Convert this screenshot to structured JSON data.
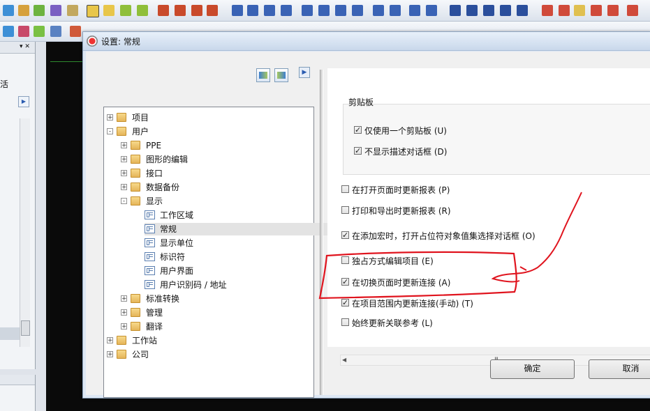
{
  "app": {
    "left_panel_partial_text": "活"
  },
  "dialog": {
    "title": "设置: 常规",
    "tree": [
      {
        "label": "项目",
        "level": 0,
        "expander": "+",
        "icon": "folder-icon"
      },
      {
        "label": "用户",
        "level": 0,
        "expander": "-",
        "icon": "folder-icon"
      },
      {
        "label": "PPE",
        "level": 1,
        "expander": "+",
        "icon": "folder-icon"
      },
      {
        "label": "图形的编辑",
        "level": 1,
        "expander": "+",
        "icon": "folder-icon"
      },
      {
        "label": "接口",
        "level": 1,
        "expander": "+",
        "icon": "folder-icon"
      },
      {
        "label": "数据备份",
        "level": 1,
        "expander": "+",
        "icon": "folder-icon"
      },
      {
        "label": "显示",
        "level": 1,
        "expander": "-",
        "icon": "folder-icon"
      },
      {
        "label": "工作区域",
        "level": 2,
        "expander": "",
        "icon": "page-icon"
      },
      {
        "label": "常规",
        "level": 2,
        "expander": "",
        "icon": "page-icon",
        "selected": true
      },
      {
        "label": "显示单位",
        "level": 2,
        "expander": "",
        "icon": "page-icon"
      },
      {
        "label": "标识符",
        "level": 2,
        "expander": "",
        "icon": "page-icon"
      },
      {
        "label": "用户界面",
        "level": 2,
        "expander": "",
        "icon": "page-icon"
      },
      {
        "label": "用户识别码 / 地址",
        "level": 2,
        "expander": "",
        "icon": "page-icon"
      },
      {
        "label": "标准转换",
        "level": 1,
        "expander": "+",
        "icon": "folder-icon"
      },
      {
        "label": "管理",
        "level": 1,
        "expander": "+",
        "icon": "folder-icon"
      },
      {
        "label": "翻译",
        "level": 1,
        "expander": "+",
        "icon": "folder-icon"
      },
      {
        "label": "工作站",
        "level": 0,
        "expander": "+",
        "icon": "folder-icon"
      },
      {
        "label": "公司",
        "level": 0,
        "expander": "+",
        "icon": "folder-icon"
      }
    ],
    "clipboard_group": {
      "title": "剪贴板",
      "options": [
        {
          "label": "仅使用一个剪贴板 (U)",
          "checked": true
        },
        {
          "label": "不显示描述对话框 (D)",
          "checked": true
        }
      ]
    },
    "options": [
      {
        "label": "在打开页面时更新报表 (P)",
        "checked": false
      },
      {
        "label": "打印和导出时更新报表 (R)",
        "checked": false
      },
      {
        "label": "在添加宏时，打开占位符对象值集选择对话框 (O)",
        "checked": true
      },
      {
        "label": "独占方式编辑项目 (E)",
        "checked": false
      },
      {
        "label": "在切换页面时更新连接 (A)",
        "checked": true
      },
      {
        "label": "在项目范围内更新连接(手动) (T)",
        "checked": true
      },
      {
        "label": "始终更新关联参考 (L)",
        "checked": false
      }
    ],
    "scroll_grip": "III",
    "buttons": {
      "ok": "确定",
      "cancel": "取消"
    },
    "check_mark": "✓"
  },
  "annotation_color": "#e0141e"
}
